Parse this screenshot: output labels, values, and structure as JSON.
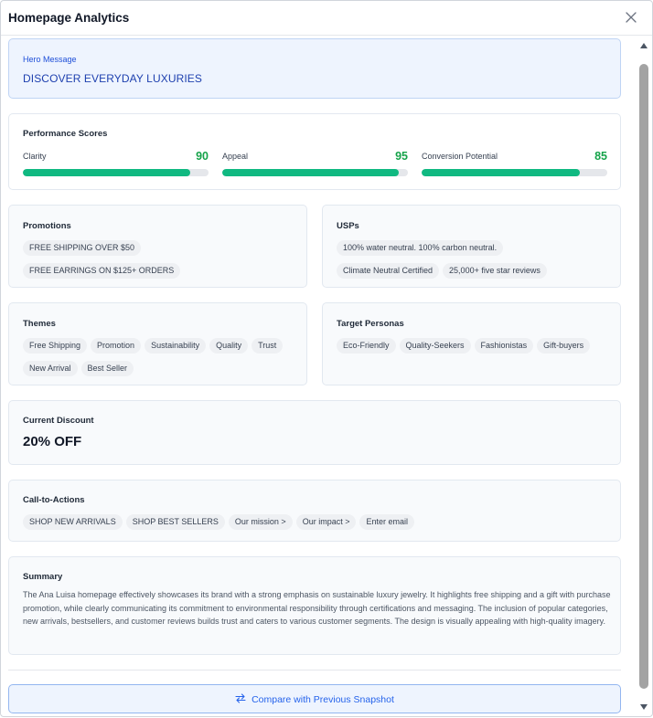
{
  "dialog": {
    "title": "Homepage Analytics",
    "close_icon": "close-icon"
  },
  "hero": {
    "label": "Hero Message",
    "text": "DISCOVER EVERYDAY LUXURIES"
  },
  "scores": {
    "title": "Performance Scores",
    "metrics": [
      {
        "label": "Clarity",
        "value": "90",
        "fraction": 0.9
      },
      {
        "label": "Appeal",
        "value": "95",
        "fraction": 0.95
      },
      {
        "label": "Conversion Potential",
        "value": "85",
        "fraction": 0.85
      }
    ]
  },
  "promotions": {
    "title": "Promotions",
    "items": [
      "FREE SHIPPING OVER $50",
      "FREE EARRINGS ON $125+ ORDERS"
    ]
  },
  "usps": {
    "title": "USPs",
    "items": [
      "100% water neutral. 100% carbon neutral.",
      "Climate Neutral Certified",
      "25,000+ five star reviews"
    ]
  },
  "themes": {
    "title": "Themes",
    "items": [
      "Free Shipping",
      "Promotion",
      "Sustainability",
      "Quality",
      "Trust",
      "New Arrival",
      "Best Seller"
    ]
  },
  "personas": {
    "title": "Target Personas",
    "items": [
      "Eco-Friendly",
      "Quality-Seekers",
      "Fashionistas",
      "Gift-buyers"
    ]
  },
  "discount": {
    "title": "Current Discount",
    "value": "20% OFF"
  },
  "ctas": {
    "title": "Call-to-Actions",
    "items": [
      "SHOP NEW ARRIVALS",
      "SHOP BEST SELLERS",
      "Our mission >",
      "Our impact >",
      "Enter email"
    ]
  },
  "summary": {
    "title": "Summary",
    "text": "The Ana Luisa homepage effectively showcases its brand with a strong emphasis on sustainable luxury jewelry. It highlights free shipping and a gift with purchase promotion, while clearly communicating its commitment to environmental responsibility through certifications and messaging. The inclusion of popular categories, new arrivals, bestsellers, and customer reviews builds trust and caters to various customer segments. The design is visually appealing with high-quality imagery."
  },
  "footer": {
    "compare_label": "Compare with Previous Snapshot",
    "compare_icon": "swap-arrows-icon"
  },
  "colors": {
    "accent": "#2563eb",
    "score_value": "#16a34a",
    "bar_fill": "#10b981"
  }
}
